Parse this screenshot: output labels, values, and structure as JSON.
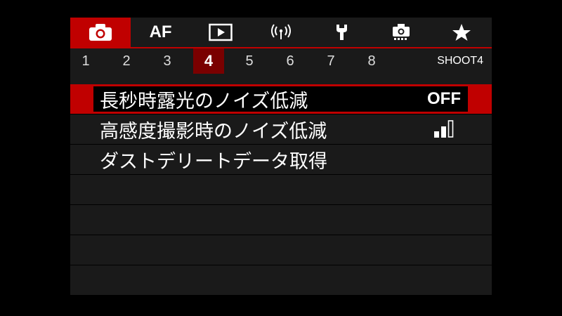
{
  "tabs": [
    {
      "icon": "camera-icon",
      "label": "",
      "active": true
    },
    {
      "icon": "",
      "label": "AF",
      "active": false
    },
    {
      "icon": "playback-icon",
      "label": "",
      "active": false
    },
    {
      "icon": "wireless-icon",
      "label": "",
      "active": false
    },
    {
      "icon": "wrench-icon",
      "label": "",
      "active": false
    },
    {
      "icon": "custom-camera-icon",
      "label": "",
      "active": false
    },
    {
      "icon": "star-icon",
      "label": "",
      "active": false
    }
  ],
  "subtabs": [
    "1",
    "2",
    "3",
    "4",
    "5",
    "6",
    "7",
    "8"
  ],
  "active_subtab": "4",
  "page_code": "SHOOT4",
  "menu": {
    "items": [
      {
        "label": "長秒時露光のノイズ低減",
        "value": "OFF",
        "selected": true
      },
      {
        "label": "高感度撮影時のノイズ低減",
        "value_icon": "noise-reduction-level-icon",
        "level": "2 of 3",
        "selected": false
      },
      {
        "label": "ダストデリートデータ取得",
        "value": "",
        "selected": false
      }
    ],
    "empty_rows": 4
  },
  "colors": {
    "accent_red": "#c00000",
    "subtab_active": "#7a0000",
    "panel_bg": "#1a1a1a"
  }
}
